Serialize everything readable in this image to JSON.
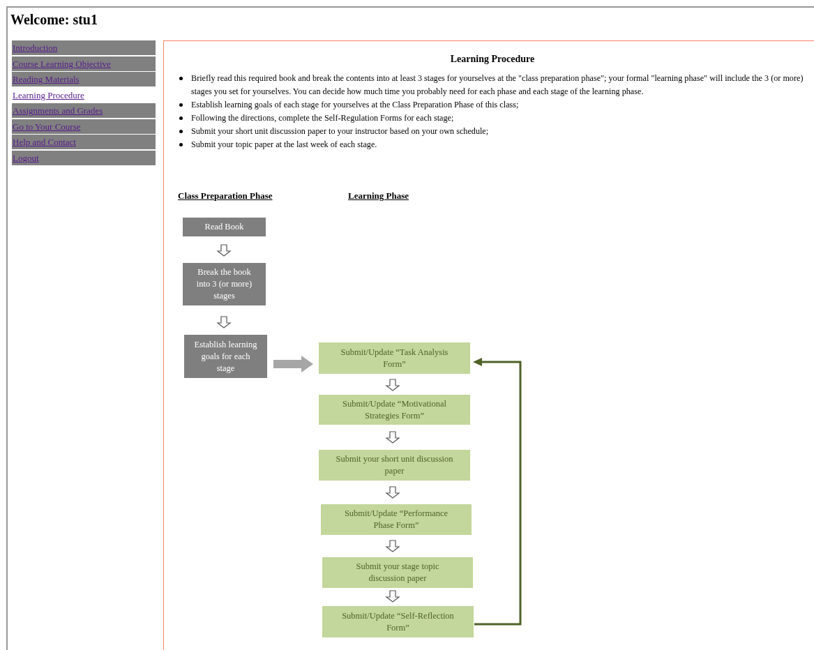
{
  "welcome": "Welcome: stu1",
  "nav": [
    {
      "label": "Introduction",
      "selected": false
    },
    {
      "label": "Course Learning Objective",
      "selected": false
    },
    {
      "label": "Reading Materials",
      "selected": false
    },
    {
      "label": "Learning Procedure",
      "selected": true
    },
    {
      "label": "Assignments and Grades",
      "selected": false
    },
    {
      "label": "Go to Your Course",
      "selected": false
    },
    {
      "label": "Help and Contact",
      "selected": false
    },
    {
      "label": "Logout",
      "selected": false
    }
  ],
  "heading": "Learning Procedure",
  "bullets": [
    "Briefly read this required book and break the contents into at least 3 stages for yourselves at the \"class preparation phase\"; your formal \"learning phase\" will include the 3 (or more) stages you set for yourselves. You can decide how much time you probably need for each phase and each stage of the learning phase.",
    "Establish learning goals of each stage for yourselves at the Class Preparation Phase of this class;",
    "Following the directions, complete the Self-Regulation Forms for each stage;",
    "Submit your short unit discussion paper to your instructor based on your own schedule;",
    "Submit your topic paper at the last week of each stage."
  ],
  "diagram": {
    "preparation_title": "Class Preparation Phase",
    "learning_title": "Learning Phase",
    "preparation_steps": [
      "Read Book",
      "Break the book into 3 (or more) stages",
      "Establish learning goals for each stage"
    ],
    "learning_steps": [
      "Submit/Update “Task Analysis Form”",
      "Submit/Update “Motivational Strategies Form”",
      "Submit your short unit discussion paper",
      "Submit/Update “Performance Phase Form”",
      "Submit your stage topic discussion paper",
      "Submit/Update “Self-Reflection Form”"
    ]
  }
}
